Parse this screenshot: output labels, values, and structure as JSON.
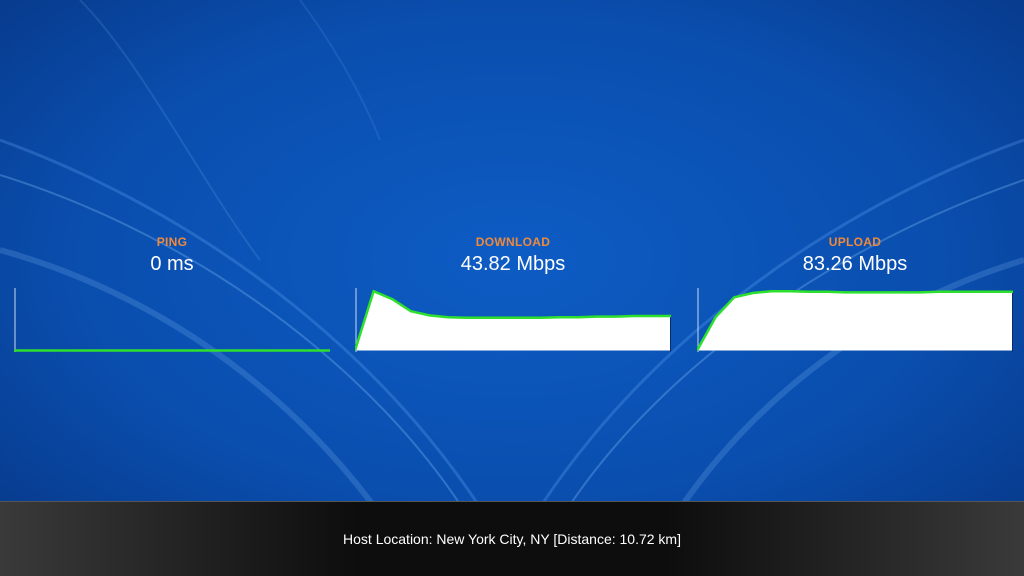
{
  "metrics": {
    "ping": {
      "label": "PING",
      "value": "0 ms"
    },
    "download": {
      "label": "DOWNLOAD",
      "value": "43.82 Mbps"
    },
    "upload": {
      "label": "UPLOAD",
      "value": "83.26 Mbps"
    }
  },
  "graphs": {
    "ping": [
      0,
      0,
      0,
      0,
      0,
      0,
      0,
      0,
      0,
      0,
      0,
      0
    ],
    "download": [
      0,
      0.98,
      0.85,
      0.65,
      0.58,
      0.55,
      0.54,
      0.54,
      0.54,
      0.54,
      0.54,
      0.55,
      0.55,
      0.56,
      0.56,
      0.57,
      0.57,
      0.57
    ],
    "upload": [
      0,
      0.55,
      0.88,
      0.95,
      0.98,
      0.98,
      0.97,
      0.97,
      0.96,
      0.96,
      0.96,
      0.96,
      0.96,
      0.97,
      0.97,
      0.97,
      0.97,
      0.97
    ]
  },
  "footer": {
    "host_location": "Host Location: New York City, NY [Distance: 10.72 km]"
  },
  "colors": {
    "label": "#f08a3a",
    "graph_line": "#2ee02e",
    "graph_fill": "#ffffff",
    "background": "#0b4fb0"
  }
}
